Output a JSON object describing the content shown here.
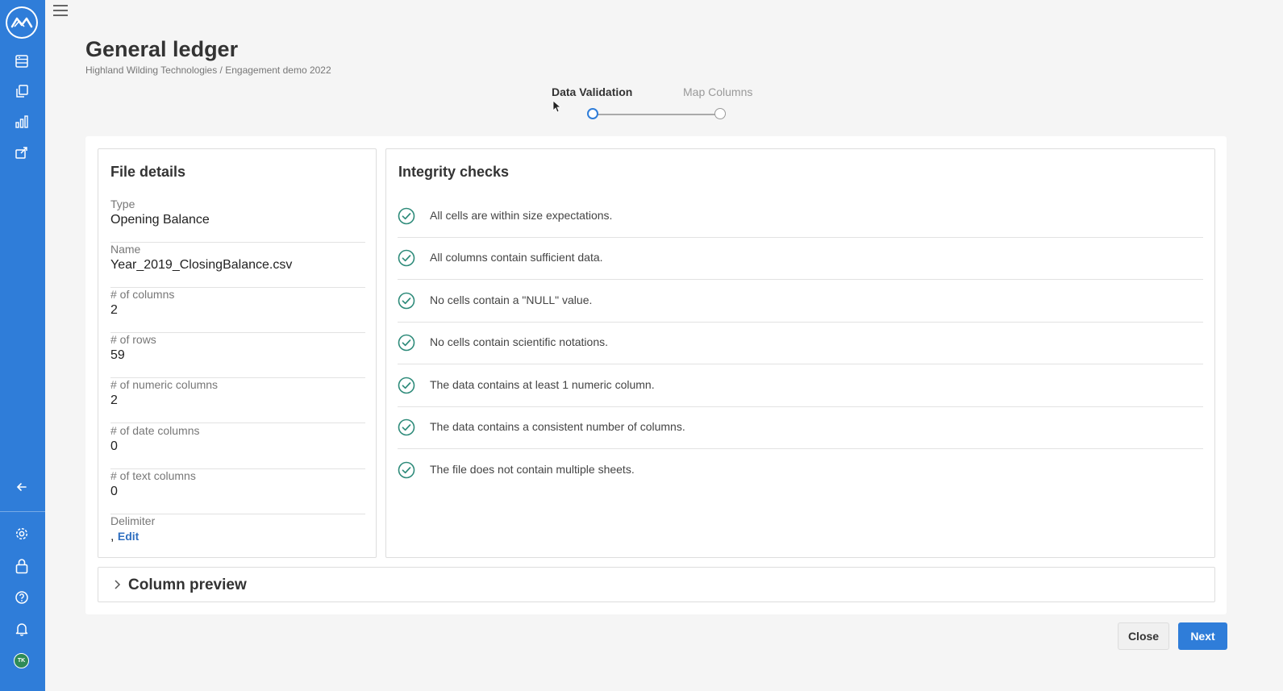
{
  "sidebar": {
    "logo_icon": "brand-logo-icon",
    "nav_icons": [
      "database-icon",
      "documents-icon",
      "bar-chart-icon",
      "export-icon"
    ],
    "collapse_icon": "arrow-left-icon",
    "bottom_icons": [
      "gear-icon",
      "lock-icon",
      "help-icon",
      "bell-icon"
    ],
    "avatar_initials": "TK",
    "color": "#2f7dd9"
  },
  "header": {
    "title": "General ledger",
    "breadcrumb": "Highland Wilding Technologies / Engagement demo 2022"
  },
  "stepper": {
    "steps": [
      {
        "label": "Data Validation",
        "active": true
      },
      {
        "label": "Map Columns",
        "active": false
      }
    ]
  },
  "file_details": {
    "title": "File details",
    "fields": [
      {
        "label": "Type",
        "value": "Opening Balance"
      },
      {
        "label": "Name",
        "value": "Year_2019_ClosingBalance.csv"
      },
      {
        "label": "# of columns",
        "value": "2"
      },
      {
        "label": "# of rows",
        "value": "59"
      },
      {
        "label": "# of numeric columns",
        "value": "2"
      },
      {
        "label": "# of date columns",
        "value": "0"
      },
      {
        "label": "# of text columns",
        "value": "0"
      }
    ],
    "delimiter": {
      "label": "Delimiter",
      "value": ",",
      "edit_label": "Edit"
    }
  },
  "integrity": {
    "title": "Integrity checks",
    "checks": [
      "All cells are within size expectations.",
      "All columns contain sufficient data.",
      "No cells contain a \"NULL\" value.",
      "No cells contain scientific notations.",
      "The data contains at least 1 numeric column.",
      "The data contains a consistent number of columns.",
      "The file does not contain multiple sheets."
    ],
    "check_color": "#2e8b7a"
  },
  "column_preview": {
    "title": "Column preview"
  },
  "footer": {
    "close_label": "Close",
    "next_label": "Next"
  }
}
